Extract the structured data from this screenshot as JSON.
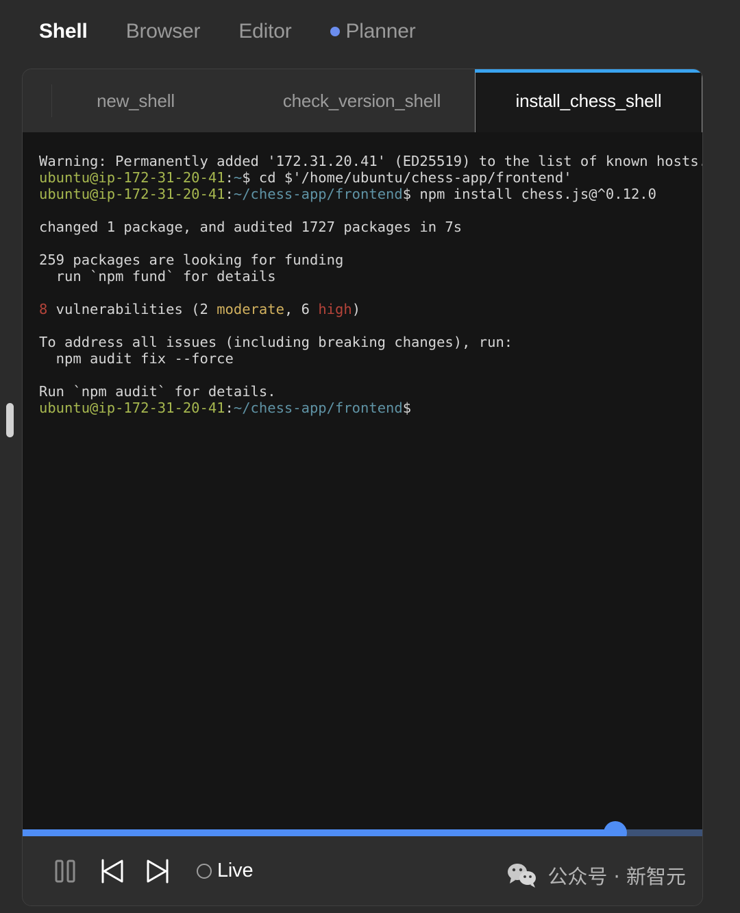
{
  "nav": {
    "items": [
      {
        "label": "Shell",
        "active": true,
        "dot": false
      },
      {
        "label": "Browser",
        "active": false,
        "dot": false
      },
      {
        "label": "Editor",
        "active": false,
        "dot": false
      },
      {
        "label": "Planner",
        "active": false,
        "dot": true
      }
    ],
    "dot_color": "#6b8dee"
  },
  "tabs": [
    {
      "label": "new_shell",
      "active": false
    },
    {
      "label": "check_version_shell",
      "active": false
    },
    {
      "label": "install_chess_shell",
      "active": true
    }
  ],
  "tab_accent_color": "#3aa3ef",
  "terminal": {
    "prompt_user_color": "#a7b84f",
    "prompt_path_color": "#5f93a5",
    "error_color": "#b5443a",
    "warn_color": "#d2b15e",
    "lines": [
      {
        "segments": [
          {
            "text": "Warning: Permanently added '172.31.20.41' (ED25519) to the list of known hosts.",
            "color": "default"
          }
        ]
      },
      {
        "segments": [
          {
            "text": "ubuntu@ip-172-31-20-41",
            "color": "user"
          },
          {
            "text": ":",
            "color": "default"
          },
          {
            "text": "~",
            "color": "path"
          },
          {
            "text": "$ cd $'/home/ubuntu/chess-app/frontend'",
            "color": "default"
          }
        ]
      },
      {
        "segments": [
          {
            "text": "ubuntu@ip-172-31-20-41",
            "color": "user"
          },
          {
            "text": ":",
            "color": "default"
          },
          {
            "text": "~/chess-app/frontend",
            "color": "path"
          },
          {
            "text": "$ npm install chess.js@^0.12.0",
            "color": "default"
          }
        ]
      },
      {
        "segments": [
          {
            "text": "",
            "color": "default"
          }
        ]
      },
      {
        "segments": [
          {
            "text": "changed 1 package, and audited 1727 packages in 7s",
            "color": "default"
          }
        ]
      },
      {
        "segments": [
          {
            "text": "",
            "color": "default"
          }
        ]
      },
      {
        "segments": [
          {
            "text": "259 packages are looking for funding",
            "color": "default"
          }
        ]
      },
      {
        "segments": [
          {
            "text": "  run `npm fund` for details",
            "color": "default"
          }
        ]
      },
      {
        "segments": [
          {
            "text": "",
            "color": "default"
          }
        ]
      },
      {
        "segments": [
          {
            "text": "8",
            "color": "red"
          },
          {
            "text": " vulnerabilities (2 ",
            "color": "default"
          },
          {
            "text": "moderate",
            "color": "yellow"
          },
          {
            "text": ", 6 ",
            "color": "default"
          },
          {
            "text": "high",
            "color": "red"
          },
          {
            "text": ")",
            "color": "default"
          }
        ]
      },
      {
        "segments": [
          {
            "text": "",
            "color": "default"
          }
        ]
      },
      {
        "segments": [
          {
            "text": "To address all issues (including breaking changes), run:",
            "color": "default"
          }
        ]
      },
      {
        "segments": [
          {
            "text": "  npm audit fix --force",
            "color": "default"
          }
        ]
      },
      {
        "segments": [
          {
            "text": "",
            "color": "default"
          }
        ]
      },
      {
        "segments": [
          {
            "text": "Run `npm audit` for details.",
            "color": "default"
          }
        ]
      },
      {
        "segments": [
          {
            "text": "ubuntu@ip-172-31-20-41",
            "color": "user"
          },
          {
            "text": ":",
            "color": "default"
          },
          {
            "text": "~/chess-app/frontend",
            "color": "path"
          },
          {
            "text": "$",
            "color": "default"
          }
        ]
      }
    ]
  },
  "scrubber": {
    "progress_percent": 87,
    "played_color": "#4f8df5",
    "remaining_color": "#3c5277"
  },
  "controls": {
    "pause_icon": "pause-icon",
    "previous_icon": "skip-previous-icon",
    "next_icon": "skip-next-icon",
    "live_label": "Live"
  },
  "watermark": {
    "icon": "wechat-icon",
    "text": "公众号 · 新智元"
  }
}
